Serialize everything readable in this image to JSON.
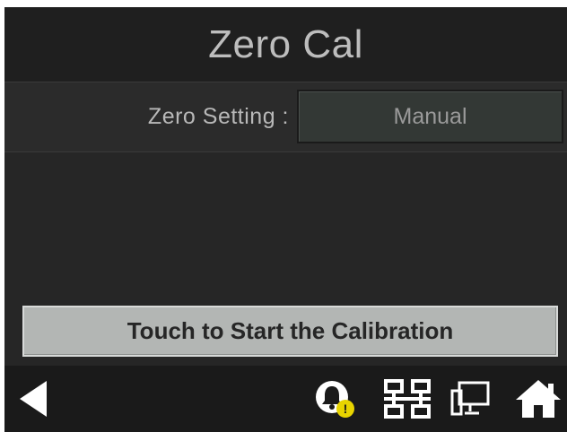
{
  "header": {
    "title": "Zero Cal"
  },
  "zero_setting": {
    "label": "Zero Setting :",
    "value": "Manual"
  },
  "actions": {
    "start_label": "Touch to Start the Calibration"
  },
  "footer": {
    "icons": [
      "back-icon",
      "alarm-bell-icon",
      "network-icon",
      "display-icon",
      "home-icon"
    ],
    "alarm_badge": "!"
  },
  "colors": {
    "background": "#262626",
    "header": "#1f1f1f",
    "footer": "#1a1a1a",
    "button": "#b3b6b4",
    "value_box": "#333835",
    "badge": "#e8d400"
  }
}
